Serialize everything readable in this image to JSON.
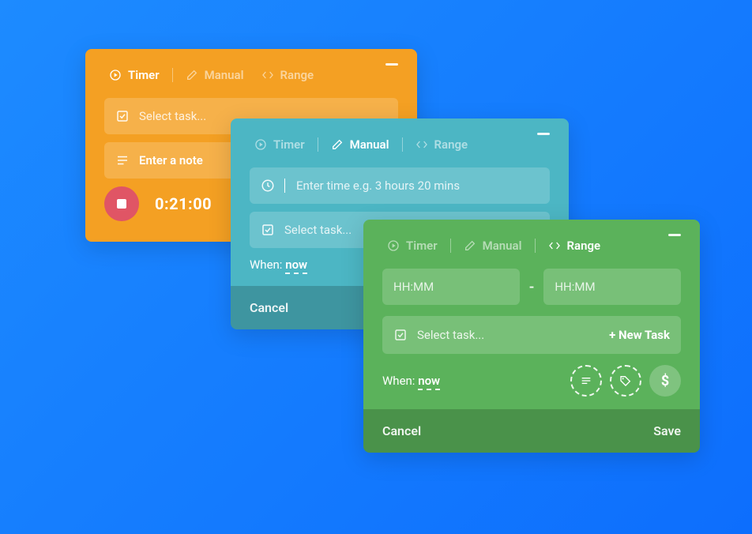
{
  "tabs": {
    "timer": "Timer",
    "manual": "Manual",
    "range": "Range"
  },
  "orange": {
    "select_task_ph": "Select task...",
    "note_ph": "Enter a note",
    "elapsed": "0:21:00"
  },
  "teal": {
    "time_input_ph": "Enter time e.g. 3 hours 20 mins",
    "select_task_ph": "Select task...",
    "when_label": "When:",
    "when_value": "now",
    "cancel": "Cancel"
  },
  "green": {
    "from_ph": "HH:MM",
    "to_ph": "HH:MM",
    "dash": "-",
    "select_task_ph": "Select task...",
    "new_task": "+ New Task",
    "when_label": "When:",
    "when_value": "now",
    "dollar": "$",
    "cancel": "Cancel",
    "save": "Save"
  }
}
